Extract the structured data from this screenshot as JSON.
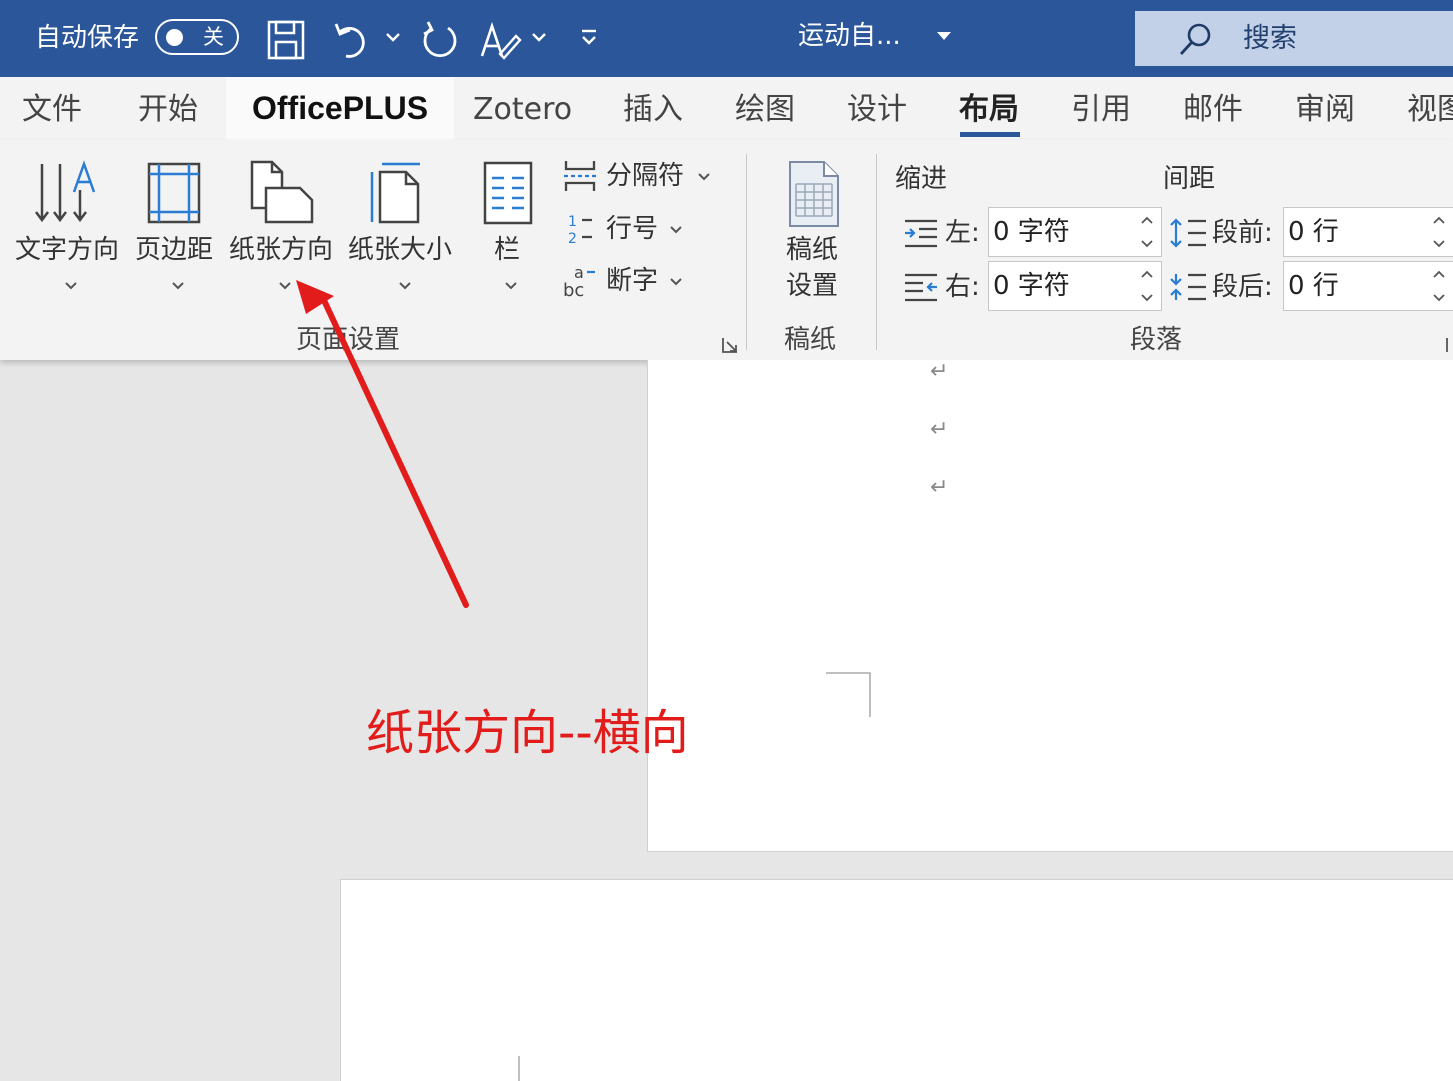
{
  "titlebar": {
    "autosave_label": "自动保存",
    "autosave_state": "关",
    "document_name": "运动自...",
    "search_label": "搜索",
    "icons": [
      "save-icon",
      "undo-icon",
      "redo-icon",
      "format-painter-icon",
      "customize-icon"
    ]
  },
  "tabs": [
    {
      "label": "文件"
    },
    {
      "label": "开始"
    },
    {
      "label": "OfficePLUS"
    },
    {
      "label": "Zotero"
    },
    {
      "label": "插入"
    },
    {
      "label": "绘图"
    },
    {
      "label": "设计"
    },
    {
      "label": "布局"
    },
    {
      "label": "引用"
    },
    {
      "label": "邮件"
    },
    {
      "label": "审阅"
    },
    {
      "label": "视图"
    }
  ],
  "active_tab": "布局",
  "ribbon": {
    "page_setup": {
      "group_label": "页面设置",
      "text_direction": "文字方向",
      "margins": "页边距",
      "orientation": "纸张方向",
      "size": "纸张大小",
      "columns": "栏",
      "breaks": "分隔符",
      "line_numbers": "行号",
      "hyphenation": "断字"
    },
    "manuscript": {
      "group_label": "稿纸",
      "button_line1": "稿纸",
      "button_line2": "设置"
    },
    "paragraph": {
      "group_label": "段落",
      "indent_header": "缩进",
      "spacing_header": "间距",
      "indent_left_label": "左:",
      "indent_left_value": "0 字符",
      "indent_right_label": "右:",
      "indent_right_value": "0 字符",
      "spacing_before_label": "段前:",
      "spacing_before_value": "0 行",
      "spacing_after_label": "段后:",
      "spacing_after_value": "0 行"
    }
  },
  "annotation": {
    "text": "纸张方向--横向",
    "color": "#e21b1b"
  },
  "document": {
    "paragraph_mark": "↵"
  },
  "colors": {
    "titlebar": "#2b579a",
    "ribbon": "#f3f3f3",
    "workspace": "#e6e6e6"
  }
}
